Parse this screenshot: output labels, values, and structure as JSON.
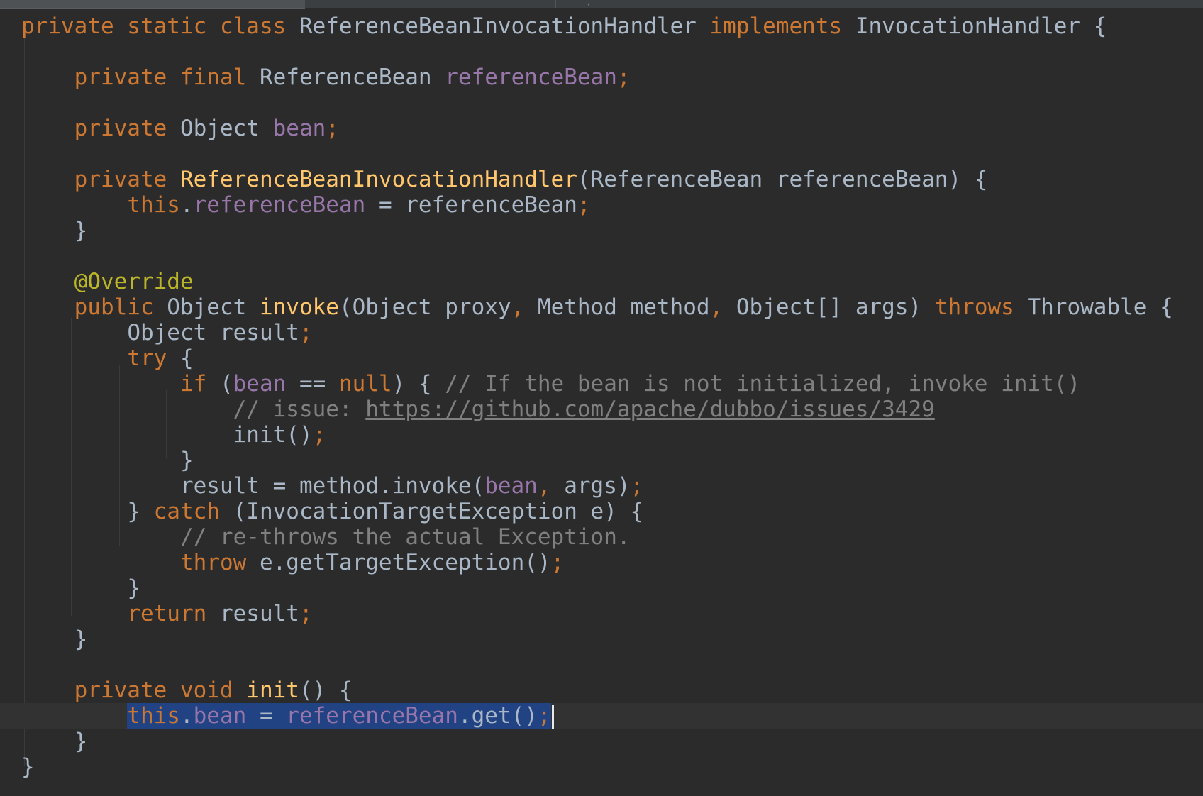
{
  "editor": {
    "theme": "darcula",
    "colors": {
      "background": "#2b2b2b",
      "current_line": "#323232",
      "selection": "#214283",
      "keyword": "#cc7832",
      "field": "#9876aa",
      "function": "#ffc66d",
      "annotation": "#bbb529",
      "comment": "#808080",
      "text": "#a9b7c6"
    }
  },
  "lines": [
    {
      "indent": 0,
      "tokens": [
        {
          "t": "private static class",
          "c": "kw"
        },
        {
          "t": " ReferenceBeanInvocationHandler ",
          "c": "plain"
        },
        {
          "t": "implements",
          "c": "kw"
        },
        {
          "t": " InvocationHandler {",
          "c": "plain"
        }
      ]
    },
    {
      "indent": 0,
      "tokens": []
    },
    {
      "indent": 4,
      "tokens": [
        {
          "t": "private final",
          "c": "kw"
        },
        {
          "t": " ReferenceBean ",
          "c": "plain"
        },
        {
          "t": "referenceBean",
          "c": "field"
        },
        {
          "t": ";",
          "c": "kw"
        }
      ]
    },
    {
      "indent": 0,
      "tokens": []
    },
    {
      "indent": 4,
      "tokens": [
        {
          "t": "private",
          "c": "kw"
        },
        {
          "t": " Object ",
          "c": "plain"
        },
        {
          "t": "bean",
          "c": "field"
        },
        {
          "t": ";",
          "c": "kw"
        }
      ]
    },
    {
      "indent": 0,
      "tokens": []
    },
    {
      "indent": 4,
      "tokens": [
        {
          "t": "private ",
          "c": "kw"
        },
        {
          "t": "ReferenceBeanInvocationHandler",
          "c": "fn"
        },
        {
          "t": "(ReferenceBean referenceBean) {",
          "c": "plain"
        }
      ]
    },
    {
      "indent": 8,
      "tokens": [
        {
          "t": "this",
          "c": "kw"
        },
        {
          "t": ".",
          "c": "plain"
        },
        {
          "t": "referenceBean",
          "c": "field"
        },
        {
          "t": " = referenceBean",
          "c": "plain"
        },
        {
          "t": ";",
          "c": "kw"
        }
      ]
    },
    {
      "indent": 4,
      "tokens": [
        {
          "t": "}",
          "c": "plain"
        }
      ]
    },
    {
      "indent": 0,
      "tokens": []
    },
    {
      "indent": 4,
      "tokens": [
        {
          "t": "@Override",
          "c": "anno"
        }
      ]
    },
    {
      "indent": 4,
      "tokens": [
        {
          "t": "public",
          "c": "kw"
        },
        {
          "t": " Object ",
          "c": "plain"
        },
        {
          "t": "invoke",
          "c": "fn"
        },
        {
          "t": "(Object proxy",
          "c": "plain"
        },
        {
          "t": ",",
          "c": "kw"
        },
        {
          "t": " Method method",
          "c": "plain"
        },
        {
          "t": ",",
          "c": "kw"
        },
        {
          "t": " Object[] args) ",
          "c": "plain"
        },
        {
          "t": "throws",
          "c": "kw"
        },
        {
          "t": " Throwable {",
          "c": "plain"
        }
      ]
    },
    {
      "indent": 8,
      "tokens": [
        {
          "t": "Object result",
          "c": "plain"
        },
        {
          "t": ";",
          "c": "kw"
        }
      ]
    },
    {
      "indent": 8,
      "tokens": [
        {
          "t": "try",
          "c": "kw"
        },
        {
          "t": " {",
          "c": "plain"
        }
      ]
    },
    {
      "indent": 12,
      "tokens": [
        {
          "t": "if",
          "c": "kw"
        },
        {
          "t": " (",
          "c": "plain"
        },
        {
          "t": "bean",
          "c": "field"
        },
        {
          "t": " == ",
          "c": "plain"
        },
        {
          "t": "null",
          "c": "kw"
        },
        {
          "t": ") { ",
          "c": "plain"
        },
        {
          "t": "// If the bean is not initialized, invoke init()",
          "c": "cm"
        }
      ]
    },
    {
      "indent": 16,
      "tokens": [
        {
          "t": "// issue: ",
          "c": "cm"
        },
        {
          "t": "https://github.com/apache/dubbo/issues/3429",
          "c": "link"
        }
      ]
    },
    {
      "indent": 16,
      "tokens": [
        {
          "t": "init()",
          "c": "plain"
        },
        {
          "t": ";",
          "c": "kw"
        }
      ]
    },
    {
      "indent": 12,
      "tokens": [
        {
          "t": "}",
          "c": "plain"
        }
      ]
    },
    {
      "indent": 12,
      "tokens": [
        {
          "t": "result = method.invoke(",
          "c": "plain"
        },
        {
          "t": "bean",
          "c": "field"
        },
        {
          "t": ",",
          "c": "kw"
        },
        {
          "t": " args)",
          "c": "plain"
        },
        {
          "t": ";",
          "c": "kw"
        }
      ]
    },
    {
      "indent": 8,
      "tokens": [
        {
          "t": "} ",
          "c": "plain"
        },
        {
          "t": "catch",
          "c": "kw"
        },
        {
          "t": " (InvocationTargetException e) {",
          "c": "plain"
        }
      ]
    },
    {
      "indent": 12,
      "tokens": [
        {
          "t": "// re-throws the actual Exception.",
          "c": "cm"
        }
      ]
    },
    {
      "indent": 12,
      "tokens": [
        {
          "t": "throw",
          "c": "kw"
        },
        {
          "t": " e.getTargetException()",
          "c": "plain"
        },
        {
          "t": ";",
          "c": "kw"
        }
      ]
    },
    {
      "indent": 8,
      "tokens": [
        {
          "t": "}",
          "c": "plain"
        }
      ]
    },
    {
      "indent": 8,
      "tokens": [
        {
          "t": "return",
          "c": "kw"
        },
        {
          "t": " result",
          "c": "plain"
        },
        {
          "t": ";",
          "c": "kw"
        }
      ]
    },
    {
      "indent": 4,
      "tokens": [
        {
          "t": "}",
          "c": "plain"
        }
      ]
    },
    {
      "indent": 0,
      "tokens": []
    },
    {
      "indent": 4,
      "tokens": [
        {
          "t": "private void ",
          "c": "kw"
        },
        {
          "t": "init",
          "c": "fn"
        },
        {
          "t": "() {",
          "c": "plain"
        }
      ]
    },
    {
      "indent": 8,
      "current": true,
      "selected": true,
      "caret": true,
      "tokens": [
        {
          "t": "this",
          "c": "kw"
        },
        {
          "t": ".",
          "c": "plain"
        },
        {
          "t": "bean",
          "c": "field"
        },
        {
          "t": " = ",
          "c": "plain"
        },
        {
          "t": "referenceBean",
          "c": "field"
        },
        {
          "t": ".get()",
          "c": "plain"
        },
        {
          "t": ";",
          "c": "kw"
        }
      ]
    },
    {
      "indent": 4,
      "tokens": [
        {
          "t": "}",
          "c": "plain"
        }
      ]
    },
    {
      "indent": 0,
      "tokens": [
        {
          "t": "}",
          "c": "plain"
        }
      ]
    }
  ]
}
